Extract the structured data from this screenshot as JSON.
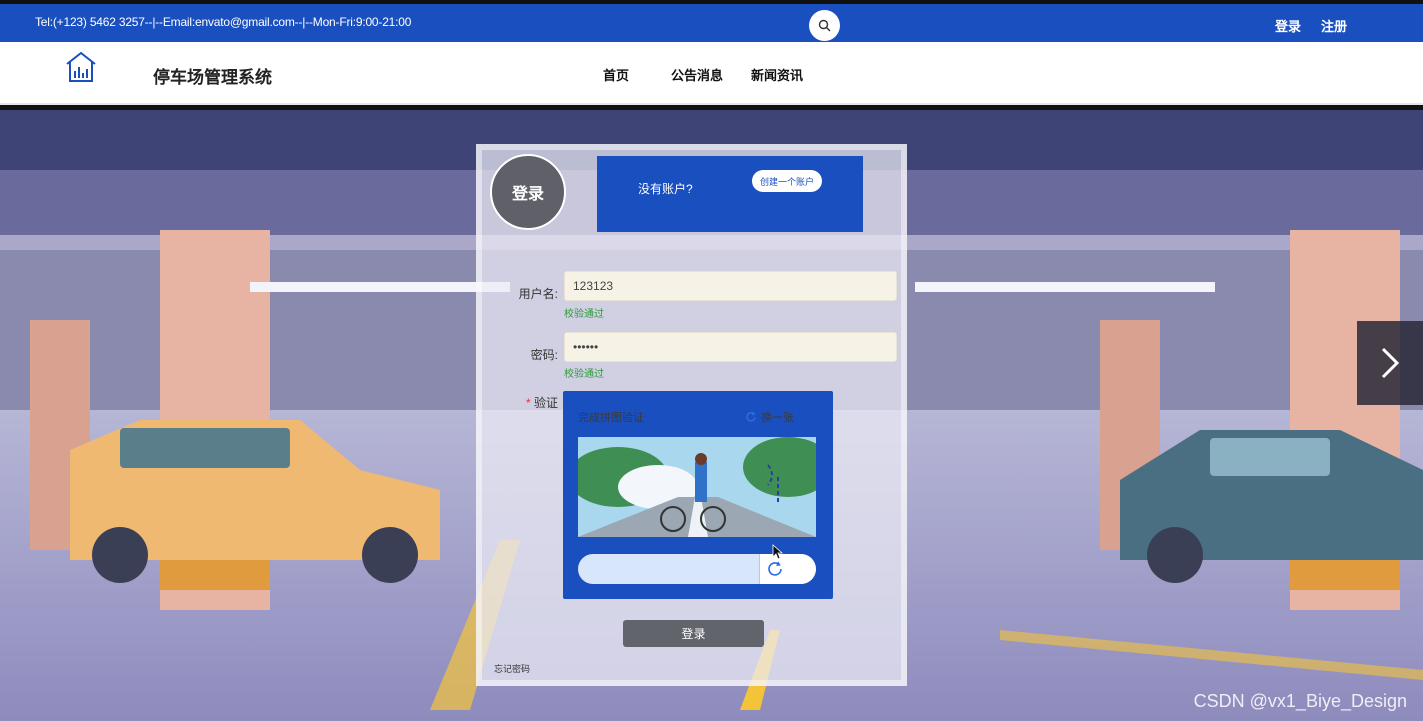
{
  "topbar": {
    "contact": "Tel:(+123) 5462 3257--|--Email:envato@gmail.com--|--Mon-Fri:9:00-21:00",
    "search_icon": "search-icon",
    "login": "登录",
    "register": "注册"
  },
  "navbar": {
    "logo_icon": "building-chart-icon",
    "title": "停车场管理系统",
    "menu": [
      {
        "label": "首页"
      },
      {
        "label": "公告消息"
      },
      {
        "label": "新闻资讯"
      }
    ]
  },
  "login_panel": {
    "avatar_title": "登录",
    "promo_question": "没有账户?",
    "create_account": "创建一个账户",
    "username_label": "用户名:",
    "username_value": "123123",
    "username_hint": "校验通过",
    "password_label": "密码:",
    "password_value": "••••••",
    "password_hint": "校验通过",
    "captcha_required_mark": "*",
    "captcha_label": "验证",
    "captcha_title": "完成拼图验证",
    "captcha_refresh": "换一张",
    "submit": "登录",
    "forgot": "忘记密码"
  },
  "carousel": {
    "next_icon": "chevron-right-icon"
  },
  "watermark": "CSDN @vx1_Biye_Design",
  "colors": {
    "brand_blue": "#1a4fc0",
    "button_gray": "#62646c",
    "hint_green": "#2e9a3c"
  }
}
